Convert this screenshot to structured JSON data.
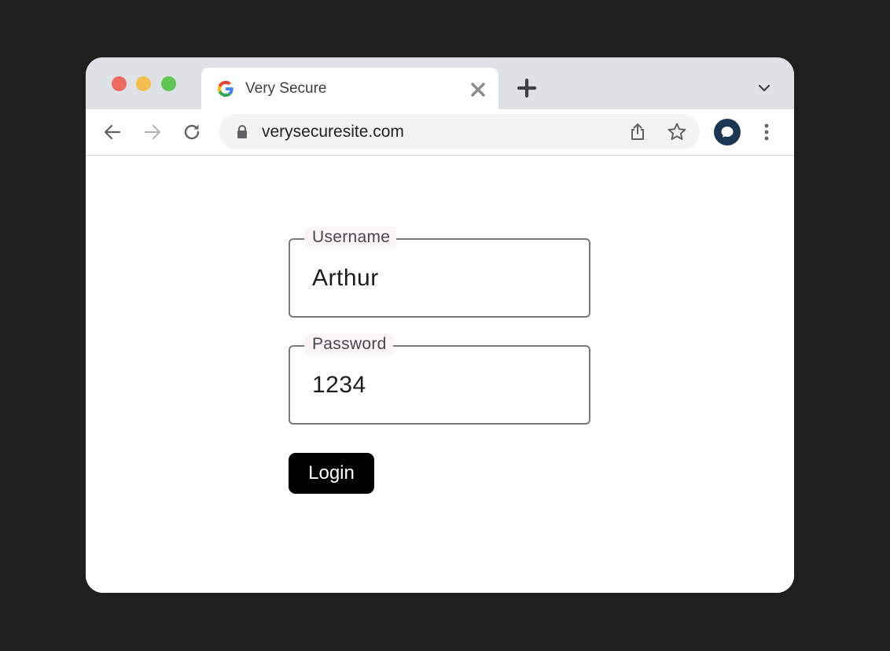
{
  "browser": {
    "tab": {
      "title": "Very Secure",
      "favicon": "google-g-icon"
    },
    "address_bar": {
      "url": "verysecuresite.com"
    },
    "icons": {
      "back": "arrow-left-icon",
      "forward": "arrow-right-icon",
      "reload": "reload-icon",
      "lock": "lock-icon",
      "share": "share-icon",
      "bookmark": "star-icon",
      "profile": "avatar-icon",
      "menu": "kebab-menu-icon",
      "new_tab": "plus-icon",
      "close_tab": "close-icon",
      "tab_search": "chevron-down-icon"
    }
  },
  "login_form": {
    "username": {
      "label": "Username",
      "value": "Arthur"
    },
    "password": {
      "label": "Password",
      "value": "1234"
    },
    "submit_label": "Login"
  },
  "colors": {
    "page_background": "#1f1f1f",
    "tabstrip": "#dee1e6",
    "button": "#000000",
    "field_border": "#7a7a7a"
  }
}
